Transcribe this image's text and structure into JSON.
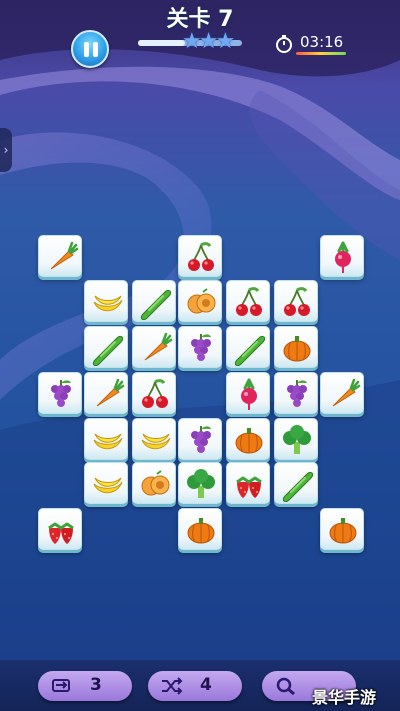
{
  "header": {
    "level_title": "关卡 7",
    "timer": "03:16",
    "stars_count": 3,
    "progress_fraction": 0.45
  },
  "side_tab": {
    "glyph": "›"
  },
  "board": {
    "tiles": [
      {
        "name": "carrot-tile",
        "fruit": "carrot"
      },
      {
        "name": "cherry-tile",
        "fruit": "cherry"
      },
      {
        "name": "radish-tile",
        "fruit": "radish"
      },
      {
        "name": "banana-tile",
        "fruit": "banana"
      },
      {
        "name": "cucumber-tile",
        "fruit": "cucumber"
      },
      {
        "name": "apricot-tile",
        "fruit": "apricot"
      },
      {
        "name": "cherry-tile",
        "fruit": "cherry"
      },
      {
        "name": "cherry-tile",
        "fruit": "cherry"
      },
      {
        "name": "cucumber-tile",
        "fruit": "cucumber"
      },
      {
        "name": "carrot-tile",
        "fruit": "carrot"
      },
      {
        "name": "grape-tile",
        "fruit": "grape"
      },
      {
        "name": "cucumber-tile",
        "fruit": "cucumber"
      },
      {
        "name": "pumpkin-tile",
        "fruit": "pumpkin"
      },
      {
        "name": "grape-tile",
        "fruit": "grape"
      },
      {
        "name": "carrot-tile",
        "fruit": "carrot"
      },
      {
        "name": "cherry-tile",
        "fruit": "cherry"
      },
      {
        "name": "radish-tile",
        "fruit": "radish"
      },
      {
        "name": "grape-tile",
        "fruit": "grape"
      },
      {
        "name": "carrot-tile",
        "fruit": "carrot"
      },
      {
        "name": "banana-tile",
        "fruit": "banana"
      },
      {
        "name": "banana-tile",
        "fruit": "banana"
      },
      {
        "name": "grape-tile",
        "fruit": "grape"
      },
      {
        "name": "pumpkin-tile",
        "fruit": "pumpkin"
      },
      {
        "name": "broccoli-tile",
        "fruit": "broccoli"
      },
      {
        "name": "banana-tile",
        "fruit": "banana"
      },
      {
        "name": "apricot-tile",
        "fruit": "apricot"
      },
      {
        "name": "broccoli-tile",
        "fruit": "broccoli"
      },
      {
        "name": "strawberry-tile",
        "fruit": "strawberry"
      },
      {
        "name": "cucumber-tile",
        "fruit": "cucumber"
      },
      {
        "name": "strawberry-tile",
        "fruit": "strawberry"
      },
      {
        "name": "pumpkin-tile",
        "fruit": "pumpkin"
      },
      {
        "name": "pumpkin-tile",
        "fruit": "pumpkin"
      }
    ]
  },
  "powerups": {
    "undo": {
      "icon": "undo-icon",
      "count": "3"
    },
    "shuffle": {
      "icon": "shuffle-icon",
      "count": "4"
    },
    "hint": {
      "icon": "magnifier-icon",
      "count": ""
    }
  },
  "watermark": "景华手游",
  "colors": {
    "background_top": "#3a2f78",
    "background_bottom": "#1c3f8a",
    "tile_face": "#ffffff",
    "tile_edge": "#6fb7cc",
    "pill": "#b596e8"
  }
}
